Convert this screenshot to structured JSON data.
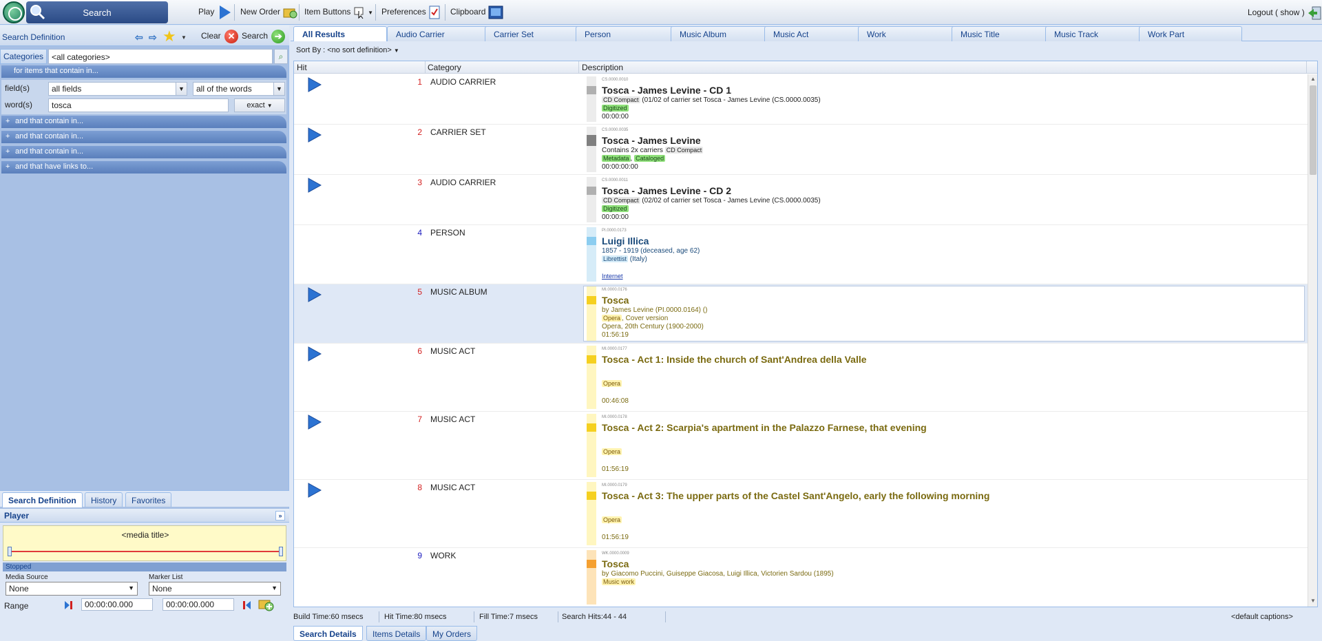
{
  "toolbar": {
    "search_label": "Search",
    "play_label": "Play",
    "new_order_label": "New Order",
    "item_buttons_label": "Item Buttons",
    "preferences_label": "Preferences",
    "clipboard_label": "Clipboard",
    "logout_label": "Logout ( show )"
  },
  "search_definition": {
    "title": "Search Definition",
    "clear_label": "Clear",
    "search_label": "Search",
    "categories_label": "Categories",
    "categories_value": "<all categories>",
    "group_header": "for items that contain in...",
    "fields_label": "field(s)",
    "fields_value": "all fields",
    "match_value": "all of the words",
    "words_label": "word(s)",
    "words_value": "tosca",
    "exact_label": "exact",
    "and_contain_1": "and that contain in...",
    "and_contain_2": "and that contain in...",
    "and_contain_3": "and that contain in...",
    "and_links": "and that have links to..."
  },
  "left_tabs": [
    "Search Definition",
    "History",
    "Favorites"
  ],
  "player": {
    "title": "Player",
    "media_title": "<media title>",
    "status": "Stopped",
    "media_source_label": "Media Source",
    "media_source_value": "None",
    "marker_list_label": "Marker List",
    "marker_list_value": "None",
    "range_label": "Range",
    "range_start": "00:00:00.000",
    "range_end": "00:00:00.000"
  },
  "result_tabs": [
    "All Results",
    "Audio Carrier",
    "Carrier Set",
    "Person",
    "Music Album",
    "Music Act",
    "Work",
    "Music Title",
    "Music Track",
    "Work Part"
  ],
  "sort": {
    "label": "Sort By :",
    "value": "<no sort definition>"
  },
  "columns": {
    "hit": "Hit",
    "category": "Category",
    "description": "Description"
  },
  "results": [
    {
      "hit": "1",
      "category": "AUDIO CARRIER",
      "code": "CS.0000.0010",
      "title": "Tosca - James Levine - CD 1",
      "line1_tag": "CD Compact",
      "line1_text": "(01/02 of carrier set Tosca - James Levine (CS.0000.0035)",
      "status_tag": "Digitized",
      "duration": "00:00:00"
    },
    {
      "hit": "2",
      "category": "CARRIER SET",
      "code": "CS.0000.0035",
      "title": "Tosca - James Levine",
      "line1_text": "Contains 2x carriers",
      "line1_tag": "CD Compact",
      "status_tag": "Metadata",
      "status_tag2": "Cataloged",
      "duration": "00:00:00:00"
    },
    {
      "hit": "3",
      "category": "AUDIO CARRIER",
      "code": "CS.0000.0011",
      "title": "Tosca - James Levine - CD 2",
      "line1_tag": "CD Compact",
      "line1_text": "(02/02 of carrier set Tosca - James Levine (CS.0000.0035)",
      "status_tag": "Digitized",
      "duration": "00:00:00"
    },
    {
      "hit": "4",
      "category": "PERSON",
      "code": "PI.0000.0173",
      "title": "Luigi Illica",
      "line1_text": "1857 - 1919 (deceased, age 62)",
      "role_tag": "Librettist",
      "role_text": "(Italy)",
      "link": "Internet"
    },
    {
      "hit": "5",
      "category": "MUSIC ALBUM",
      "code": "MI.0000.0176",
      "title": "Tosca",
      "line1_text": "by James Levine (PI.0000.0164) ()",
      "genre_tag": "Opera",
      "genre_text": ", Cover version",
      "line3_text": "Opera, 20th Century (1900-2000)",
      "duration": "01:56:19"
    },
    {
      "hit": "6",
      "category": "MUSIC ACT",
      "code": "MI.0000.0177",
      "title": "Tosca - Act 1: Inside the church of Sant'Andrea della Valle",
      "genre_tag": "Opera",
      "duration": "00:46:08"
    },
    {
      "hit": "7",
      "category": "MUSIC ACT",
      "code": "MI.0000.0178",
      "title": "Tosca - Act 2: Scarpia's apartment in the Palazzo Farnese, that evening",
      "genre_tag": "Opera",
      "duration": "01:56:19"
    },
    {
      "hit": "8",
      "category": "MUSIC ACT",
      "code": "MI.0000.0179",
      "title": "Tosca - Act 3: The upper parts of the Castel Sant'Angelo, early the following morning",
      "genre_tag": "Opera",
      "duration": "01:56:19"
    },
    {
      "hit": "9",
      "category": "WORK",
      "code": "WK.0000.0009",
      "title": "Tosca",
      "line1_text": "by Giacomo Puccini, Guiseppe Giacosa, Luigi Illica, Victorien Sardou (1895)",
      "genre_tag": "Music work"
    }
  ],
  "stats": {
    "build_time": "Build Time:60 msecs",
    "hit_time": "Hit Time:80 msecs",
    "fill_time": "Fill Time:7 msecs",
    "search_hits": "Search Hits:44 - 44",
    "captions": "<default captions>"
  },
  "bottom_tabs": [
    "Search Details",
    "Items Details",
    "My Orders"
  ],
  "colors": {
    "accent": "#15428b",
    "panel_bg": "#a8c0e4",
    "hit_red": "#d32020",
    "hit_blue": "#2020c0",
    "music_title": "#7a6a10",
    "person_title": "#1a4a7a"
  }
}
